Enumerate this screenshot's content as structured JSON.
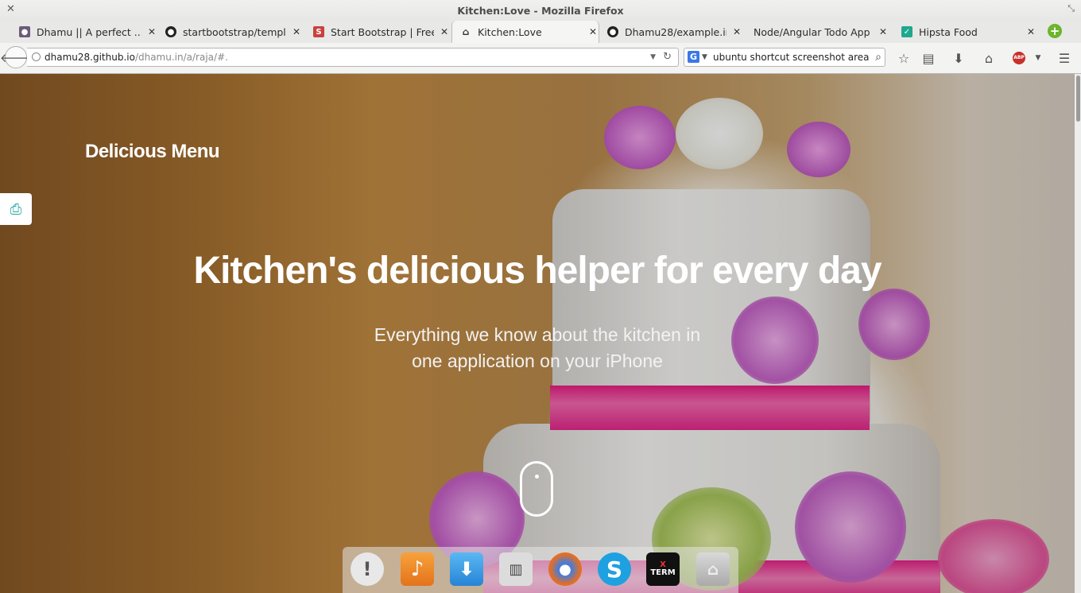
{
  "window": {
    "title": "Kitchen:Love - Mozilla Firefox"
  },
  "tabs": [
    {
      "label": "Dhamu || A perfect ...",
      "icon": "avatar-icon"
    },
    {
      "label": "startbootstrap/templ...",
      "icon": "github-icon"
    },
    {
      "label": "Start Bootstrap | Free ...",
      "icon": "startbootstrap-icon"
    },
    {
      "label": "Kitchen:Love",
      "icon": "page-icon",
      "active": true
    },
    {
      "label": "Dhamu28/example.in",
      "icon": "github-icon"
    },
    {
      "label": "Node/Angular Todo App",
      "icon": "none"
    },
    {
      "label": "Hipsta Food",
      "icon": "hipsta-icon"
    }
  ],
  "navbar": {
    "url_host": "dhamu28.github.io",
    "url_path": "/dhamu.in/a/raja/#.",
    "search_value": "ubuntu shortcut screenshot area",
    "search_engine": "G"
  },
  "page": {
    "brand": "Delicious Menu",
    "headline": "Kitchen's delicious helper for every day",
    "sub_line1": "Everything we know about the kitchen in",
    "sub_line2": "one application on your iPhone"
  },
  "dock": [
    "notification-icon",
    "music-player-icon",
    "download-icon",
    "system-settings-icon",
    "firefox-icon",
    "skype-icon",
    "xterm-icon",
    "home-folder-icon"
  ],
  "dock_labels": {
    "xterm_x": "X",
    "xterm_term": "TERM"
  },
  "colors": {
    "accent_pink": "#e8228a",
    "side_button_icon": "#1fa6a0",
    "newtab_green": "#6cb52d"
  }
}
